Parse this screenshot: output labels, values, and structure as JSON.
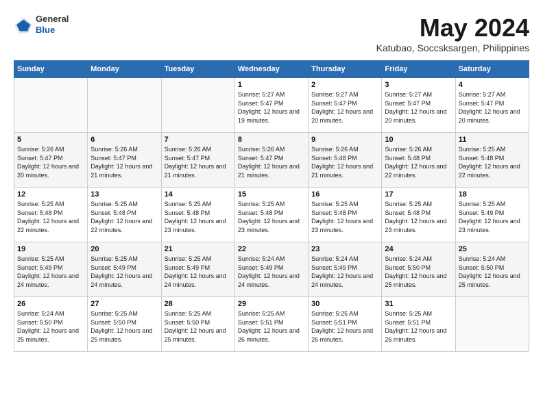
{
  "logo": {
    "general": "General",
    "blue": "Blue"
  },
  "title": "May 2024",
  "subtitle": "Katubao, Soccsksargen, Philippines",
  "days_of_week": [
    "Sunday",
    "Monday",
    "Tuesday",
    "Wednesday",
    "Thursday",
    "Friday",
    "Saturday"
  ],
  "weeks": [
    [
      {
        "day": "",
        "sunrise": "",
        "sunset": "",
        "daylight": ""
      },
      {
        "day": "",
        "sunrise": "",
        "sunset": "",
        "daylight": ""
      },
      {
        "day": "",
        "sunrise": "",
        "sunset": "",
        "daylight": ""
      },
      {
        "day": "1",
        "sunrise": "Sunrise: 5:27 AM",
        "sunset": "Sunset: 5:47 PM",
        "daylight": "Daylight: 12 hours and 19 minutes."
      },
      {
        "day": "2",
        "sunrise": "Sunrise: 5:27 AM",
        "sunset": "Sunset: 5:47 PM",
        "daylight": "Daylight: 12 hours and 20 minutes."
      },
      {
        "day": "3",
        "sunrise": "Sunrise: 5:27 AM",
        "sunset": "Sunset: 5:47 PM",
        "daylight": "Daylight: 12 hours and 20 minutes."
      },
      {
        "day": "4",
        "sunrise": "Sunrise: 5:27 AM",
        "sunset": "Sunset: 5:47 PM",
        "daylight": "Daylight: 12 hours and 20 minutes."
      }
    ],
    [
      {
        "day": "5",
        "sunrise": "Sunrise: 5:26 AM",
        "sunset": "Sunset: 5:47 PM",
        "daylight": "Daylight: 12 hours and 20 minutes."
      },
      {
        "day": "6",
        "sunrise": "Sunrise: 5:26 AM",
        "sunset": "Sunset: 5:47 PM",
        "daylight": "Daylight: 12 hours and 21 minutes."
      },
      {
        "day": "7",
        "sunrise": "Sunrise: 5:26 AM",
        "sunset": "Sunset: 5:47 PM",
        "daylight": "Daylight: 12 hours and 21 minutes."
      },
      {
        "day": "8",
        "sunrise": "Sunrise: 5:26 AM",
        "sunset": "Sunset: 5:47 PM",
        "daylight": "Daylight: 12 hours and 21 minutes."
      },
      {
        "day": "9",
        "sunrise": "Sunrise: 5:26 AM",
        "sunset": "Sunset: 5:48 PM",
        "daylight": "Daylight: 12 hours and 21 minutes."
      },
      {
        "day": "10",
        "sunrise": "Sunrise: 5:26 AM",
        "sunset": "Sunset: 5:48 PM",
        "daylight": "Daylight: 12 hours and 22 minutes."
      },
      {
        "day": "11",
        "sunrise": "Sunrise: 5:25 AM",
        "sunset": "Sunset: 5:48 PM",
        "daylight": "Daylight: 12 hours and 22 minutes."
      }
    ],
    [
      {
        "day": "12",
        "sunrise": "Sunrise: 5:25 AM",
        "sunset": "Sunset: 5:48 PM",
        "daylight": "Daylight: 12 hours and 22 minutes."
      },
      {
        "day": "13",
        "sunrise": "Sunrise: 5:25 AM",
        "sunset": "Sunset: 5:48 PM",
        "daylight": "Daylight: 12 hours and 22 minutes."
      },
      {
        "day": "14",
        "sunrise": "Sunrise: 5:25 AM",
        "sunset": "Sunset: 5:48 PM",
        "daylight": "Daylight: 12 hours and 23 minutes."
      },
      {
        "day": "15",
        "sunrise": "Sunrise: 5:25 AM",
        "sunset": "Sunset: 5:48 PM",
        "daylight": "Daylight: 12 hours and 23 minutes."
      },
      {
        "day": "16",
        "sunrise": "Sunrise: 5:25 AM",
        "sunset": "Sunset: 5:48 PM",
        "daylight": "Daylight: 12 hours and 23 minutes."
      },
      {
        "day": "17",
        "sunrise": "Sunrise: 5:25 AM",
        "sunset": "Sunset: 5:48 PM",
        "daylight": "Daylight: 12 hours and 23 minutes."
      },
      {
        "day": "18",
        "sunrise": "Sunrise: 5:25 AM",
        "sunset": "Sunset: 5:49 PM",
        "daylight": "Daylight: 12 hours and 23 minutes."
      }
    ],
    [
      {
        "day": "19",
        "sunrise": "Sunrise: 5:25 AM",
        "sunset": "Sunset: 5:49 PM",
        "daylight": "Daylight: 12 hours and 24 minutes."
      },
      {
        "day": "20",
        "sunrise": "Sunrise: 5:25 AM",
        "sunset": "Sunset: 5:49 PM",
        "daylight": "Daylight: 12 hours and 24 minutes."
      },
      {
        "day": "21",
        "sunrise": "Sunrise: 5:25 AM",
        "sunset": "Sunset: 5:49 PM",
        "daylight": "Daylight: 12 hours and 24 minutes."
      },
      {
        "day": "22",
        "sunrise": "Sunrise: 5:24 AM",
        "sunset": "Sunset: 5:49 PM",
        "daylight": "Daylight: 12 hours and 24 minutes."
      },
      {
        "day": "23",
        "sunrise": "Sunrise: 5:24 AM",
        "sunset": "Sunset: 5:49 PM",
        "daylight": "Daylight: 12 hours and 24 minutes."
      },
      {
        "day": "24",
        "sunrise": "Sunrise: 5:24 AM",
        "sunset": "Sunset: 5:50 PM",
        "daylight": "Daylight: 12 hours and 25 minutes."
      },
      {
        "day": "25",
        "sunrise": "Sunrise: 5:24 AM",
        "sunset": "Sunset: 5:50 PM",
        "daylight": "Daylight: 12 hours and 25 minutes."
      }
    ],
    [
      {
        "day": "26",
        "sunrise": "Sunrise: 5:24 AM",
        "sunset": "Sunset: 5:50 PM",
        "daylight": "Daylight: 12 hours and 25 minutes."
      },
      {
        "day": "27",
        "sunrise": "Sunrise: 5:25 AM",
        "sunset": "Sunset: 5:50 PM",
        "daylight": "Daylight: 12 hours and 25 minutes."
      },
      {
        "day": "28",
        "sunrise": "Sunrise: 5:25 AM",
        "sunset": "Sunset: 5:50 PM",
        "daylight": "Daylight: 12 hours and 25 minutes."
      },
      {
        "day": "29",
        "sunrise": "Sunrise: 5:25 AM",
        "sunset": "Sunset: 5:51 PM",
        "daylight": "Daylight: 12 hours and 26 minutes."
      },
      {
        "day": "30",
        "sunrise": "Sunrise: 5:25 AM",
        "sunset": "Sunset: 5:51 PM",
        "daylight": "Daylight: 12 hours and 26 minutes."
      },
      {
        "day": "31",
        "sunrise": "Sunrise: 5:25 AM",
        "sunset": "Sunset: 5:51 PM",
        "daylight": "Daylight: 12 hours and 26 minutes."
      },
      {
        "day": "",
        "sunrise": "",
        "sunset": "",
        "daylight": ""
      }
    ]
  ]
}
